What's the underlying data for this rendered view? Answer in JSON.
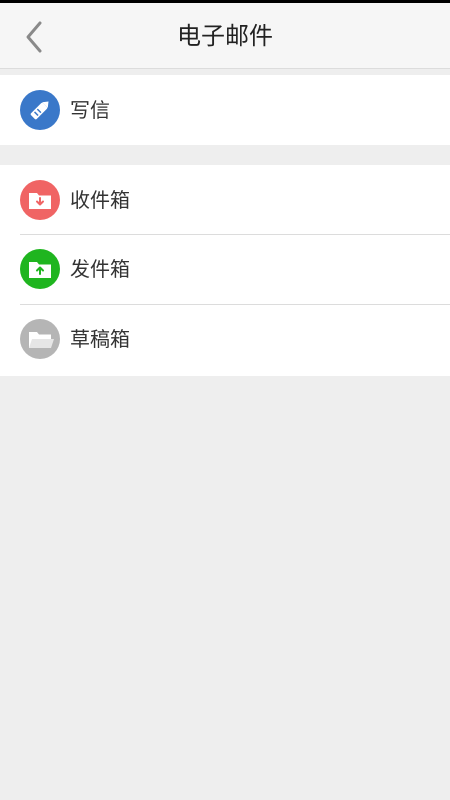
{
  "header": {
    "title": "电子邮件",
    "back_icon": "chevron-left-icon"
  },
  "compose": {
    "label": "写信",
    "icon": "pencil-icon",
    "color": "#3a78c9"
  },
  "folders": [
    {
      "label": "收件箱",
      "icon": "inbox-folder-icon",
      "color": "#f06464"
    },
    {
      "label": "发件箱",
      "icon": "outbox-folder-icon",
      "color": "#1fb51f"
    },
    {
      "label": "草稿箱",
      "icon": "drafts-folder-icon",
      "color": "#b5b5b5"
    }
  ],
  "colors": {
    "background": "#eeeeee",
    "header_background": "#f6f6f6",
    "divider": "#dcdcdc",
    "text": "#333333"
  }
}
